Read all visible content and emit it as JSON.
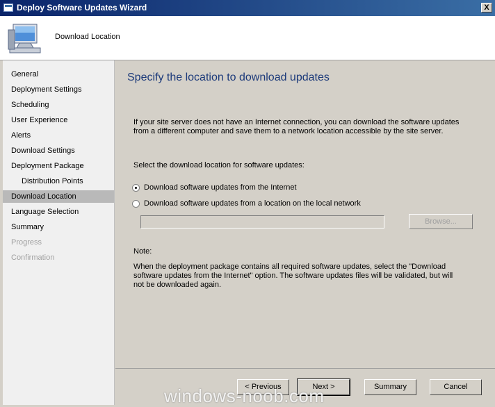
{
  "window": {
    "title": "Deploy Software Updates Wizard",
    "close_glyph": "X"
  },
  "header": {
    "title": "Download Location"
  },
  "nav": {
    "items": [
      {
        "label": "General"
      },
      {
        "label": "Deployment Settings"
      },
      {
        "label": "Scheduling"
      },
      {
        "label": "User Experience"
      },
      {
        "label": "Alerts"
      },
      {
        "label": "Download Settings"
      },
      {
        "label": "Deployment Package"
      },
      {
        "label": "Distribution Points"
      },
      {
        "label": "Download Location",
        "active": true
      },
      {
        "label": "Language Selection"
      },
      {
        "label": "Summary"
      },
      {
        "label": "Progress",
        "disabled": true
      },
      {
        "label": "Confirmation",
        "disabled": true
      }
    ]
  },
  "content": {
    "heading": "Specify the location to download updates",
    "intro_line1": "If your site server does not have an Internet connection, you can download the software updates",
    "intro_line2": "from a different computer and save them to a network location accessible by the site server.",
    "select_label": "Select the download location for software updates:",
    "radio_internet": "Download software updates from the Internet",
    "radio_local": "Download software updates from a location on the local network",
    "selected_option": "internet",
    "path_value": "",
    "browse_label": "Browse...",
    "note_label": "Note:",
    "note_line1": "When the deployment package contains all required software updates, select the \"Download",
    "note_line2": "software updates from the Internet\" option. The software updates files will be validated, but will",
    "note_line3": "not be downloaded again."
  },
  "buttons": {
    "previous": "< Previous",
    "next": "Next >",
    "summary": "Summary",
    "cancel": "Cancel"
  },
  "watermark": "windows-noob.com"
}
